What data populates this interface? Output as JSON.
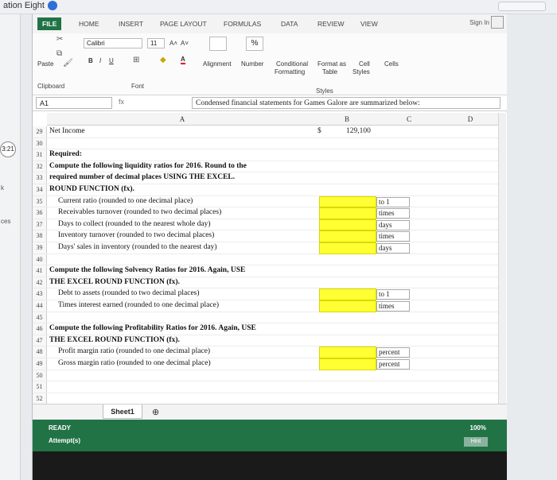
{
  "top_title": "ation Eight",
  "side_badge": "3:21",
  "side_texts": [
    "k",
    "ces"
  ],
  "tabs": [
    "FILE",
    "HOME",
    "INSERT",
    "PAGE LAYOUT",
    "FORMULAS",
    "DATA",
    "REVIEW",
    "VIEW"
  ],
  "sign_in": "Sign In",
  "ribbon": {
    "paste": "Paste",
    "font_name": "Calibri",
    "font_size": "11",
    "bold": "B",
    "italic": "I",
    "underline": "U",
    "alignment": "Alignment",
    "number": "Number",
    "percent": "%",
    "conditional": "Conditional",
    "formatting": "Formatting",
    "format_as": "Format as",
    "table": "Table",
    "cell": "Cell",
    "styles_btn": "Styles",
    "cells": "Cells",
    "group_clipboard": "Clipboard",
    "group_font": "Font",
    "group_styles": "Styles"
  },
  "formula_bar": {
    "name_box": "A1",
    "fx": "fx",
    "content": "Condensed financial statements for Games Galore are summarized below:"
  },
  "columns": [
    "A",
    "B",
    "C",
    "D"
  ],
  "rows": [
    {
      "n": "29",
      "a": "Net Income",
      "dollar": "$",
      "b": "129,100"
    },
    {
      "n": "30",
      "a": ""
    },
    {
      "n": "31",
      "a": "Required:",
      "bold": true
    },
    {
      "n": "32",
      "a": "Compute the following liquidity ratios for 2016. Round to the",
      "bold": true
    },
    {
      "n": "33",
      "a": "required number of decimal places USING THE EXCEL.",
      "bold": true
    },
    {
      "n": "34",
      "a": "ROUND FUNCTION (fx).",
      "bold": true
    },
    {
      "n": "35",
      "a": "Current ratio (rounded to one decimal place)",
      "indent": true,
      "yellow": true,
      "unit": "to 1"
    },
    {
      "n": "36",
      "a": "Receivables turnover (rounded to two decimal places)",
      "indent": true,
      "yellow": true,
      "unit": "times"
    },
    {
      "n": "37",
      "a": "Days to collect (rounded to the nearest whole day)",
      "indent": true,
      "yellow": true,
      "unit": "days"
    },
    {
      "n": "38",
      "a": "Inventory turnover (rounded to two decimal places)",
      "indent": true,
      "yellow": true,
      "unit": "times"
    },
    {
      "n": "39",
      "a": "Days' sales in inventory (rounded to the nearest day)",
      "indent": true,
      "yellow": true,
      "unit": "days"
    },
    {
      "n": "40",
      "a": ""
    },
    {
      "n": "41",
      "a": "Compute the following Solvency Ratios for 2016. Again, USE",
      "bold": true
    },
    {
      "n": "42",
      "a": "THE EXCEL ROUND FUNCTION (fx).",
      "bold": true
    },
    {
      "n": "43",
      "a": "Debt to assets (rounded to two decimal places)",
      "indent": true,
      "yellow": true,
      "unit": "to 1"
    },
    {
      "n": "44",
      "a": "Times interest earned (rounded to one decimal place)",
      "indent": true,
      "yellow": true,
      "unit": "times"
    },
    {
      "n": "45",
      "a": ""
    },
    {
      "n": "46",
      "a": "Compute the following Profitability Ratios for 2016. Again, USE",
      "bold": true
    },
    {
      "n": "47",
      "a": "THE EXCEL ROUND FUNCTION (fx).",
      "bold": true
    },
    {
      "n": "48",
      "a": "Profit margin ratio (rounded to one decimal place)",
      "indent": true,
      "yellow": true,
      "unit": "percent"
    },
    {
      "n": "49",
      "a": "Gross margin ratio (rounded to one decimal place)",
      "indent": true,
      "yellow": true,
      "unit": "percent"
    },
    {
      "n": "50",
      "a": ""
    },
    {
      "n": "51",
      "a": ""
    },
    {
      "n": "52",
      "a": ""
    }
  ],
  "sheet_tab": "Sheet1",
  "status": {
    "ready": "READY",
    "attempts": "Attempt(s)",
    "zoom": "100%",
    "hint": "Hint"
  }
}
